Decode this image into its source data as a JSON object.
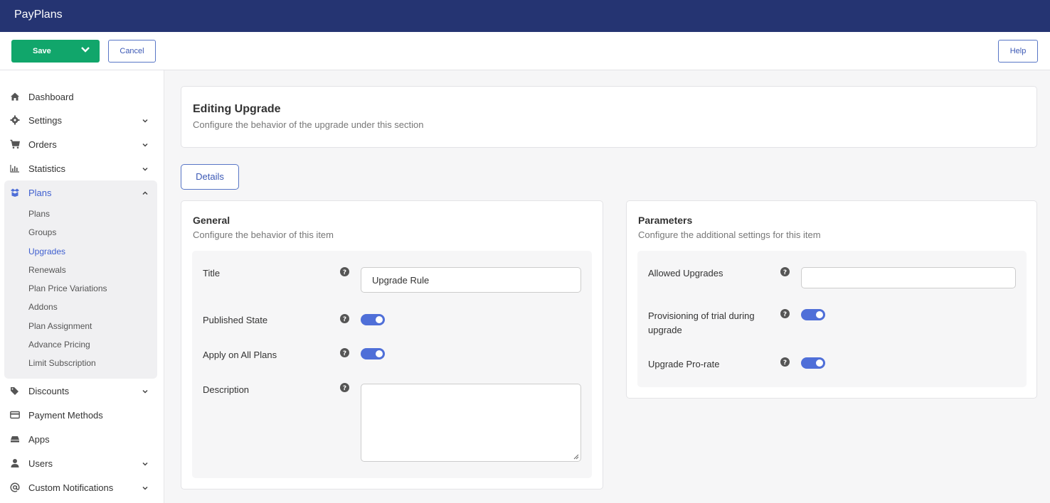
{
  "app": {
    "title": "PayPlans"
  },
  "toolbar": {
    "save_label": "Save",
    "cancel_label": "Cancel",
    "help_label": "Help"
  },
  "sidebar": {
    "items": [
      {
        "label": "Dashboard",
        "icon": "home-icon"
      },
      {
        "label": "Settings",
        "icon": "gear-icon"
      },
      {
        "label": "Orders",
        "icon": "cart-icon"
      },
      {
        "label": "Statistics",
        "icon": "bar-chart-icon"
      },
      {
        "label": "Plans",
        "icon": "box-icon"
      },
      {
        "label": "Discounts",
        "icon": "tags-icon"
      },
      {
        "label": "Payment Methods",
        "icon": "credit-card-icon"
      },
      {
        "label": "Apps",
        "icon": "drive-icon"
      },
      {
        "label": "Users",
        "icon": "user-icon"
      },
      {
        "label": "Custom Notifications",
        "icon": "at-icon"
      }
    ],
    "plans_sub": [
      "Plans",
      "Groups",
      "Upgrades",
      "Renewals",
      "Plan Price Variations",
      "Addons",
      "Plan Assignment",
      "Advance Pricing",
      "Limit Subscription"
    ]
  },
  "header": {
    "title": "Editing Upgrade",
    "subtitle": "Configure the behavior of the upgrade under this section"
  },
  "tabs": {
    "details": "Details"
  },
  "general": {
    "title": "General",
    "subtitle": "Configure the behavior of this item",
    "fields": {
      "title_label": "Title",
      "title_value": "Upgrade Rule",
      "published_label": "Published State",
      "published_on": true,
      "apply_all_label": "Apply on All Plans",
      "apply_all_on": true,
      "description_label": "Description",
      "description_value": ""
    }
  },
  "parameters": {
    "title": "Parameters",
    "subtitle": "Configure the additional settings for this item",
    "fields": {
      "allowed_label": "Allowed Upgrades",
      "allowed_value": "",
      "trial_label": "Provisioning of trial during upgrade",
      "trial_on": true,
      "prorate_label": "Upgrade Pro-rate",
      "prorate_on": true
    }
  },
  "colors": {
    "topbar": "#253472",
    "save": "#11a66b",
    "accent": "#4f6fd8"
  }
}
